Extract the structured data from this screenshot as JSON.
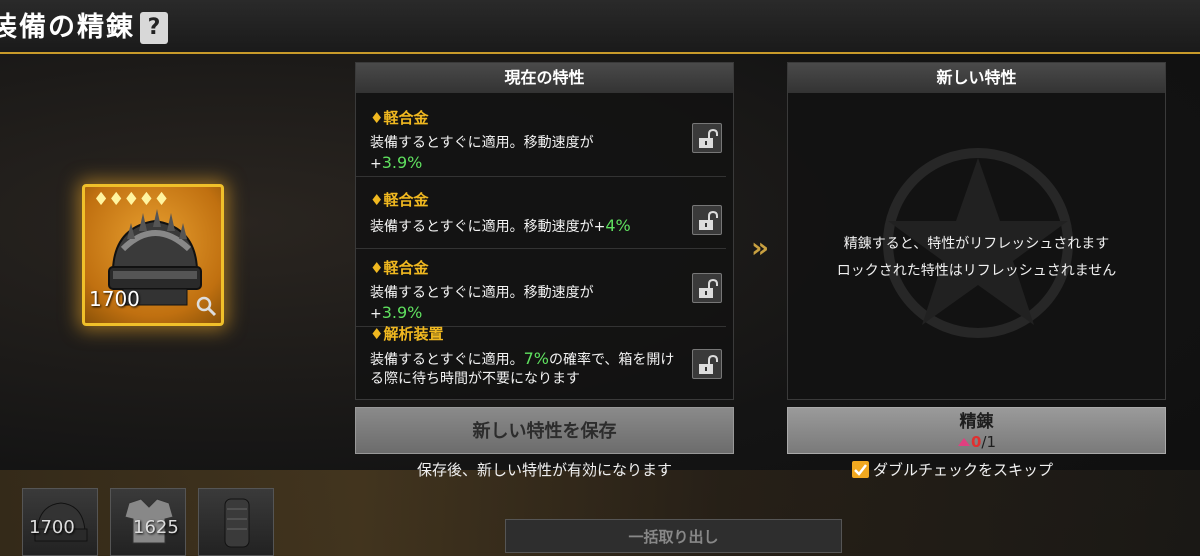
{
  "header": {
    "title": "装備の精錬",
    "help_label": "?"
  },
  "item": {
    "stars": "♦♦♦♦♦",
    "level": "1700"
  },
  "current_panel": {
    "title": "現在の特性",
    "traits": [
      {
        "name": "♦軽合金",
        "desc_prefix": "装備するとすぐに適用。移動速度が",
        "desc_value": "3.9%",
        "desc_sign": "+",
        "desc_suffix": ""
      },
      {
        "name": "♦軽合金",
        "desc_prefix": "装備するとすぐに適用。移動速度が+",
        "desc_value": "4%",
        "desc_sign": "",
        "desc_suffix": ""
      },
      {
        "name": "♦軽合金",
        "desc_prefix": "装備するとすぐに適用。移動速度が",
        "desc_value": "3.9%",
        "desc_sign": "+",
        "desc_suffix": ""
      },
      {
        "name": "♦解析装置",
        "desc_prefix": "装備するとすぐに適用。",
        "desc_value": "7%",
        "desc_sign": "",
        "desc_suffix": "の確率で、箱を開ける際に待ち時間が不要になります"
      }
    ]
  },
  "new_panel": {
    "title": "新しい特性",
    "message_line1": "精錬すると、特性がリフレッシュされます",
    "message_line2": "ロックされた特性はリフレッシュされません"
  },
  "save_button": {
    "label": "新しい特性を保存",
    "note": "保存後、新しい特性が有効になります"
  },
  "refine_button": {
    "label": "精錬",
    "cost_current": "0",
    "cost_total": "/1"
  },
  "skip_checkbox": {
    "label": "ダブルチェックをスキップ",
    "checked": true
  },
  "inventory": [
    {
      "level": "1700"
    },
    {
      "level": "1625"
    },
    {
      "level": ""
    }
  ],
  "bulk_button": {
    "label": "一括取り出し"
  },
  "colors": {
    "accent": "#f0b820",
    "green": "#5fe05f"
  }
}
